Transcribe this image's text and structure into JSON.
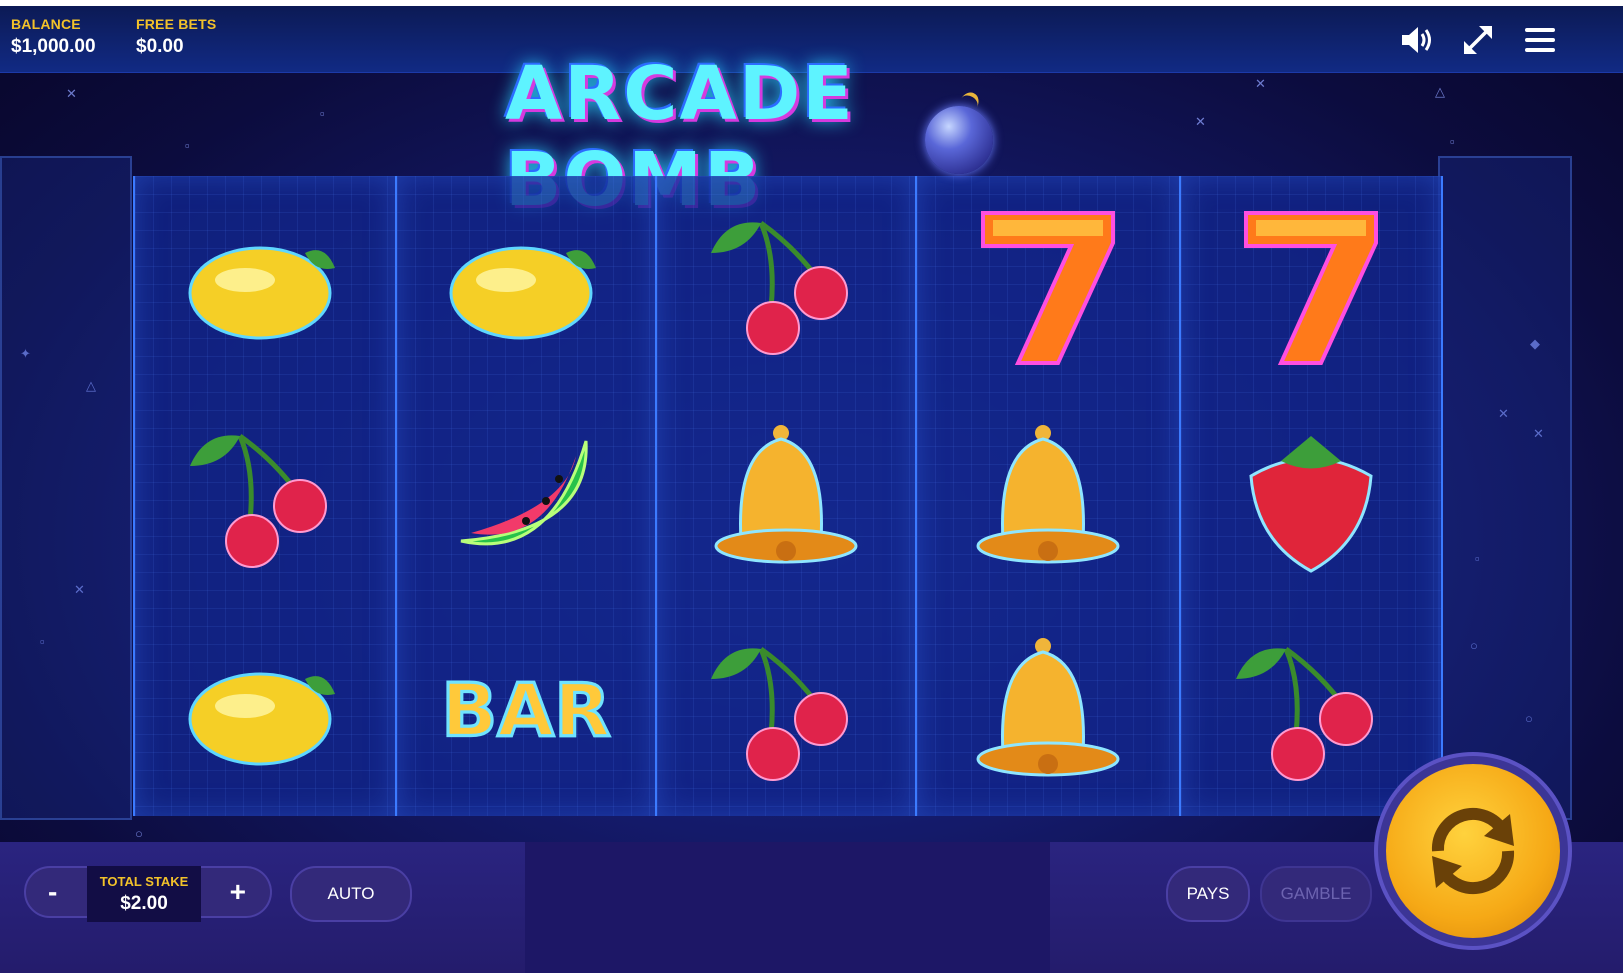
{
  "header": {
    "balance_label": "BALANCE",
    "balance_value": "$1,000.00",
    "free_bets_label": "FREE BETS",
    "free_bets_value": "$0.00",
    "icons": [
      "speaker-icon",
      "fullscreen-icon",
      "menu-icon"
    ]
  },
  "game": {
    "title": "ARCADE BOMB",
    "reels": [
      [
        "lemon",
        "cherry",
        "lemon"
      ],
      [
        "lemon",
        "watermelon",
        "bar"
      ],
      [
        "cherry",
        "bell",
        "cherry"
      ],
      [
        "seven",
        "bell",
        "bell"
      ],
      [
        "seven",
        "strawberry",
        "cherry"
      ]
    ],
    "bar_text": "BAR"
  },
  "controls": {
    "minus_label": "-",
    "plus_label": "+",
    "stake_label": "TOTAL STAKE",
    "stake_value": "$2.00",
    "auto_label": "AUTO",
    "pays_label": "PAYS",
    "gamble_label": "GAMBLE",
    "spin": "spin-icon"
  },
  "colors": {
    "accent_gold": "#f2c22a",
    "top_bar": "#112a84",
    "bottom_bar": "#2a2480",
    "spin_button": "#f6a916"
  }
}
